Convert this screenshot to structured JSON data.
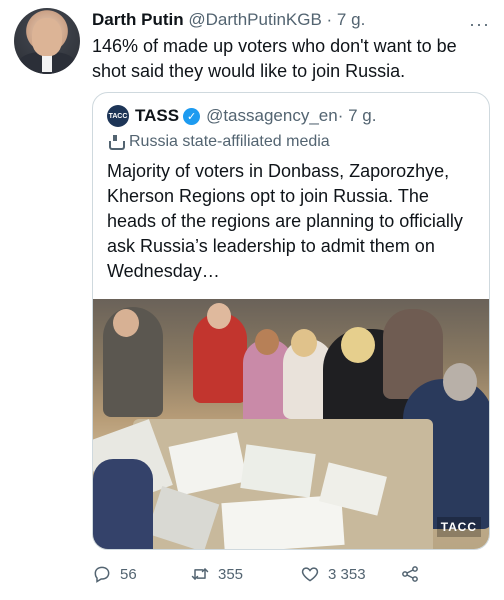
{
  "tweet": {
    "author_name": "Darth Putin",
    "author_handle": "@DarthPutinKGB",
    "time": " · 7 g.",
    "text": "146% of made up voters who don't want to be shot said they would like to join Russia.",
    "more_label": "···"
  },
  "quote": {
    "logo_text": "ТАСС",
    "author_name": "TASS",
    "author_handle": "@tassagency_en",
    "time": " · 7 g.",
    "label": "Russia state-affiliated media",
    "text": "Majority of voters in Donbass, Zaporozhye, Kherson Regions opt to join Russia. The heads of the regions are planning to officially ask Russia’s leadership to admit them on Wednesday…",
    "photo_watermark": "ТАСС"
  },
  "actions": {
    "replies": "56",
    "retweets": "355",
    "likes": "3 353"
  },
  "colors": {
    "text": "#0f1419",
    "secondary": "#536471",
    "border": "#cfd9de",
    "verified": "#1d9bf0"
  },
  "icons": [
    "more-icon",
    "verified-icon",
    "state-media-icon",
    "reply-icon",
    "retweet-icon",
    "like-icon",
    "share-icon"
  ]
}
